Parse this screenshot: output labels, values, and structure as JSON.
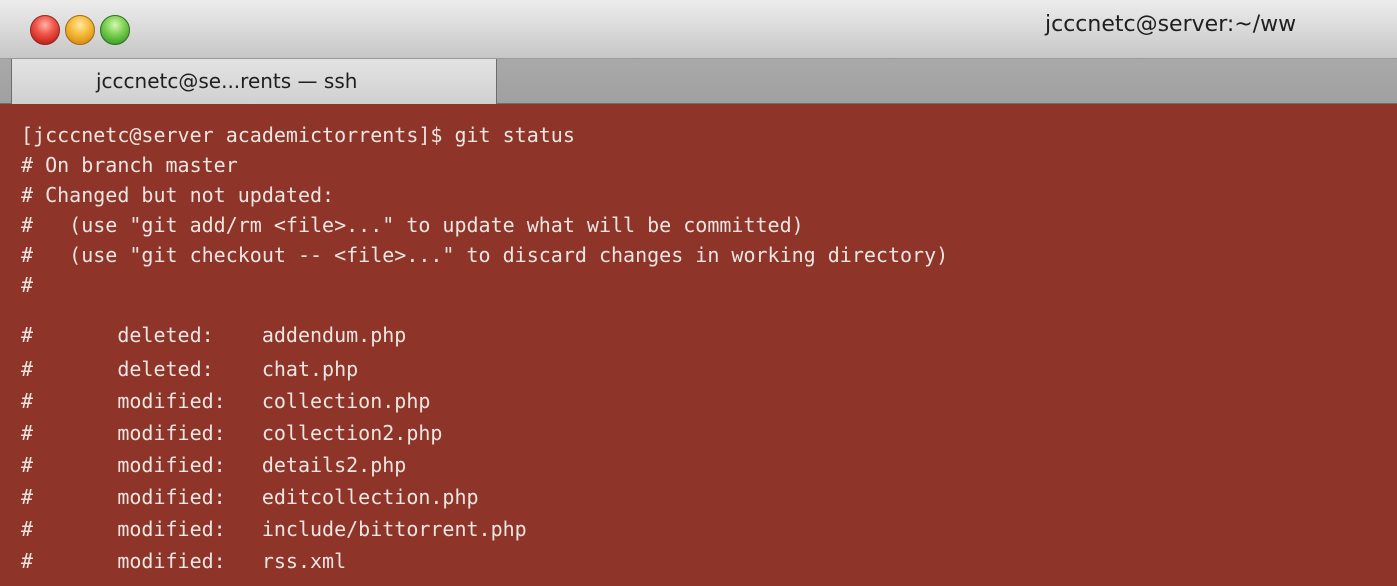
{
  "window": {
    "title": "jcccnetc@server:~/ww",
    "tab_label": "jcccnetc@se...rents — ssh"
  },
  "buttons": {
    "close": "close",
    "minimize": "minimize",
    "zoom": "zoom"
  },
  "colors": {
    "terminal_bg": "#8f3428",
    "terminal_fg": "#ebe6e2"
  },
  "terminal": {
    "lines": [
      "[jcccnetc@server academictorrents]$ git status",
      "# On branch master",
      "# Changed but not updated:",
      "#   (use \"git add/rm <file>...\" to update what will be committed)",
      "#   (use \"git checkout -- <file>...\" to discard changes in working directory)",
      "#",
      "#       deleted:    addendum.php",
      "#       deleted:    chat.php",
      "#       modified:   collection.php",
      "#       modified:   collection2.php",
      "#       modified:   details2.php",
      "#       modified:   editcollection.php",
      "#       modified:   include/bittorrent.php",
      "#       modified:   rss.xml"
    ]
  }
}
